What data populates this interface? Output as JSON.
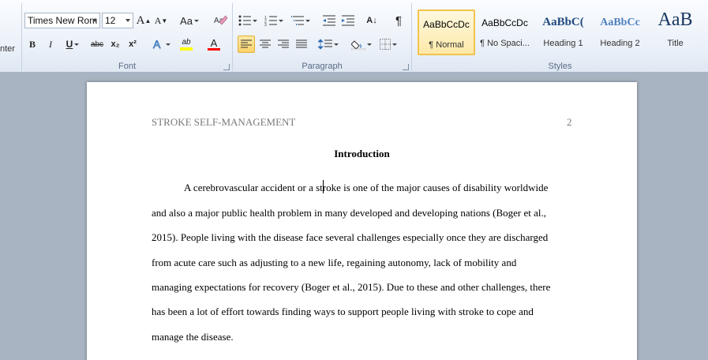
{
  "ribbon": {
    "clipped_group_label": "nter",
    "font": {
      "label": "Font",
      "font_name": "Times New Rom",
      "font_size": "12",
      "grow_label": "A",
      "shrink_label": "A",
      "case_label": "Aa",
      "bold": "B",
      "italic": "I",
      "underline": "U",
      "strike": "abc",
      "subscript": "x₂",
      "superscript": "x²",
      "font_color_letter": "A",
      "highlight_label": "ab"
    },
    "paragraph": {
      "label": "Paragraph",
      "sort_label": "A↓",
      "pilcrow": "¶"
    },
    "styles": {
      "label": "Styles",
      "items": [
        {
          "sample": "AaBbCcDc",
          "name": "¶ Normal",
          "selected": true
        },
        {
          "sample": "AaBbCcDc",
          "name": "¶ No Spaci..."
        },
        {
          "sample": "AaBbC(",
          "name": "Heading 1"
        },
        {
          "sample": "AaBbCc",
          "name": "Heading 2"
        },
        {
          "sample": "AaB",
          "name": "Title"
        }
      ]
    },
    "colors": {
      "heading_blue": "#1f497d",
      "heading2_blue": "#4f81bd",
      "font_color_bar": "#ff0000",
      "highlight_bar": "#ffff00"
    }
  },
  "document": {
    "running_head": "STROKE SELF-MANAGEMENT",
    "page_number": "2",
    "heading": "Introduction",
    "lines": [
      "A cerebrovascular accident or a stroke is one of the major causes of disability worldwide",
      "and also a major public health problem in many developed and developing nations (Boger et al.,",
      "2015). People living with the disease face several challenges especially once they are discharged",
      "from acute care such as adjusting to a new life, regaining autonomy, lack of mobility and",
      "managing expectations for recovery (Boger et al., 2015). Due to these and other challenges, there",
      "has been a lot of effort towards finding ways to support people living with stroke to cope and",
      "manage the disease."
    ]
  }
}
